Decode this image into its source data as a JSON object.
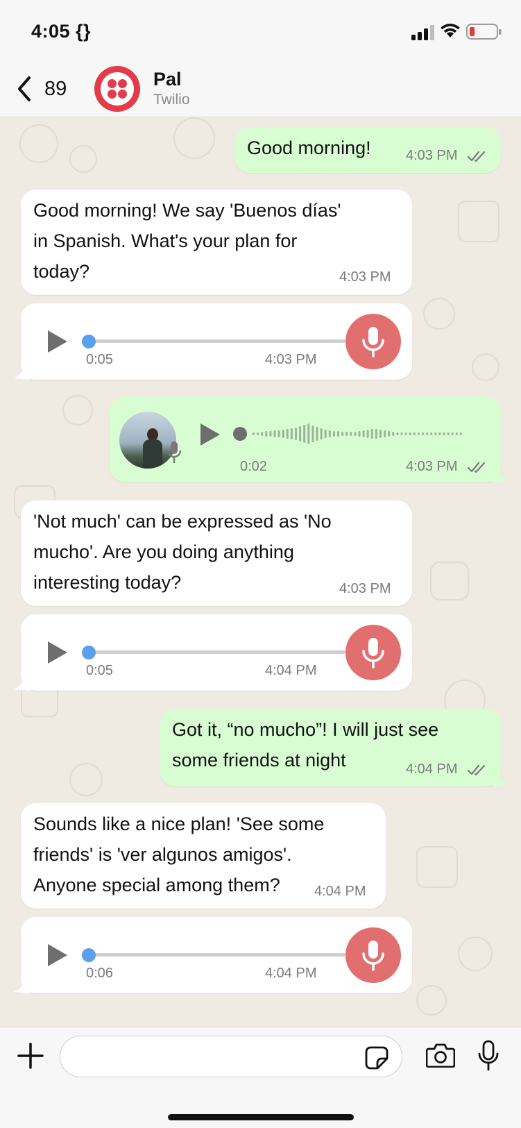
{
  "status": {
    "time": "4:05 {}"
  },
  "header": {
    "back_count": "89",
    "contact_name": "Pal",
    "contact_sub": "Twilio"
  },
  "messages": [
    {
      "dir": "out",
      "type": "text",
      "text": "Good morning!",
      "time": "4:03 PM",
      "read": true
    },
    {
      "dir": "in",
      "type": "text",
      "lines": [
        "Good morning! We say 'Buenos días'",
        "in Spanish. What's your plan for",
        "today?"
      ],
      "time": "4:03 PM"
    },
    {
      "dir": "in",
      "type": "audio",
      "duration": "0:05",
      "time": "4:03 PM",
      "progress": 0
    },
    {
      "dir": "out",
      "type": "voice",
      "duration": "0:02",
      "time": "4:03 PM",
      "read": true,
      "progress": 0
    },
    {
      "dir": "in",
      "type": "text",
      "lines": [
        "'Not much' can be expressed as 'No",
        "mucho'. Are you doing anything",
        "interesting today?"
      ],
      "time": "4:03 PM"
    },
    {
      "dir": "in",
      "type": "audio",
      "duration": "0:05",
      "time": "4:04 PM",
      "progress": 0
    },
    {
      "dir": "out",
      "type": "text",
      "lines": [
        "Got it, “no mucho”! I will just see",
        "some friends at night"
      ],
      "time": "4:04 PM",
      "read": true
    },
    {
      "dir": "in",
      "type": "text",
      "lines": [
        "Sounds like a nice plan! 'See some",
        "friends' is 'ver algunos amigos'.",
        "Anyone special among them?"
      ],
      "time": "4:04 PM"
    },
    {
      "dir": "in",
      "type": "audio",
      "duration": "0:06",
      "time": "4:04 PM",
      "progress": 0
    }
  ],
  "input": {
    "placeholder": ""
  },
  "icons": {
    "back": "chevron-left-icon",
    "plus": "plus-icon",
    "sticker": "sticker-icon",
    "camera": "camera-icon",
    "mic": "microphone-icon",
    "play": "play-icon",
    "read": "double-check-icon"
  },
  "colors": {
    "incoming": "#ffffff",
    "outgoing": "#d9fdd3",
    "chat_bg": "#efeae2",
    "mic_button": "#e26f6f",
    "progress_knob": "#5aa0ee",
    "read_ticks": "#7a7a7a"
  }
}
